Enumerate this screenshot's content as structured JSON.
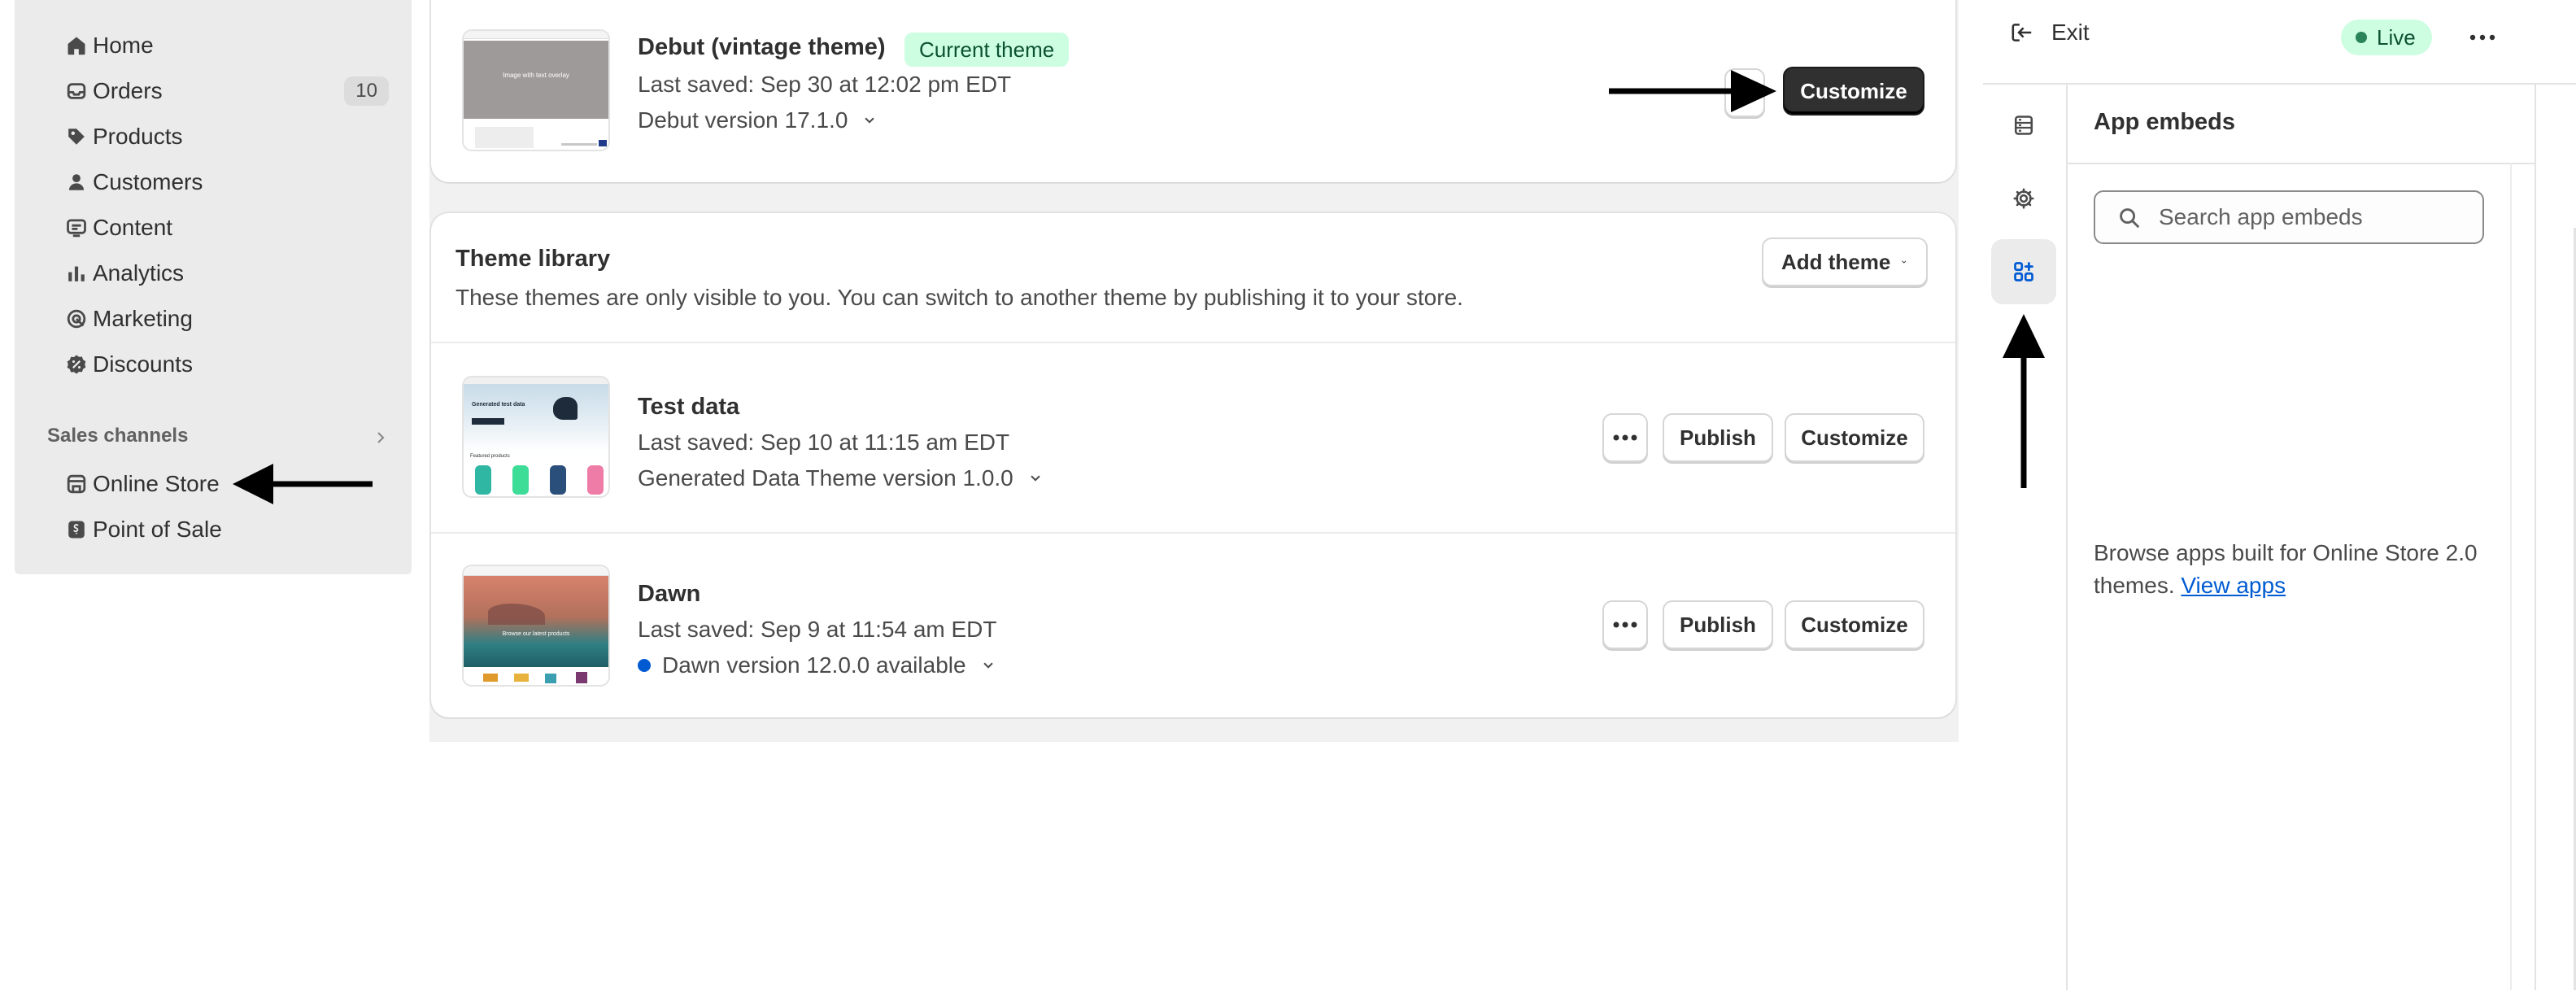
{
  "sidebar": {
    "items": [
      {
        "label": "Home",
        "icon": "home-icon"
      },
      {
        "label": "Orders",
        "icon": "orders-icon",
        "badge": "10"
      },
      {
        "label": "Products",
        "icon": "tag-icon"
      },
      {
        "label": "Customers",
        "icon": "person-icon"
      },
      {
        "label": "Content",
        "icon": "content-icon"
      },
      {
        "label": "Analytics",
        "icon": "analytics-icon"
      },
      {
        "label": "Marketing",
        "icon": "target-icon"
      },
      {
        "label": "Discounts",
        "icon": "discount-icon"
      }
    ],
    "sales_channels_heading": "Sales channels",
    "channels": [
      {
        "label": "Online Store",
        "icon": "store-icon"
      },
      {
        "label": "Point of Sale",
        "icon": "pos-icon"
      }
    ]
  },
  "current_theme": {
    "name": "Debut (vintage theme)",
    "badge": "Current theme",
    "saved": "Last saved: Sep 30 at 12:02 pm EDT",
    "version": "Debut version 17.1.0",
    "thumb_text": "Image with text overlay",
    "customize_label": "Customize"
  },
  "library": {
    "title": "Theme library",
    "description": "These themes are only visible to you. You can switch to another theme by publishing it to your store.",
    "add_theme_label": "Add theme",
    "themes": [
      {
        "name": "Test data",
        "saved": "Last saved: Sep 10 at 11:15 am EDT",
        "version": "Generated Data Theme version 1.0.0",
        "thumb_text": "Generated test data",
        "thumb_subtext": "Featured products",
        "publish_label": "Publish",
        "customize_label": "Customize"
      },
      {
        "name": "Dawn",
        "saved": "Last saved: Sep 9 at 11:54 am EDT",
        "version": "Dawn version 12.0.0 available",
        "thumb_text": "Browse our latest products",
        "publish_label": "Publish",
        "customize_label": "Customize"
      }
    ]
  },
  "editor": {
    "exit_label": "Exit",
    "live_label": "Live",
    "panel_title": "App embeds",
    "search_placeholder": "Search app embeds",
    "browse_text": "Browse apps built for Online Store 2.0 themes.",
    "browse_link": "View apps"
  },
  "colors": {
    "sidebar_bg": "#ebebeb",
    "badge_green_bg": "#cdfee1",
    "badge_green_text": "#0c5132",
    "link_blue": "#005bd3",
    "dark_button": "#303030"
  }
}
